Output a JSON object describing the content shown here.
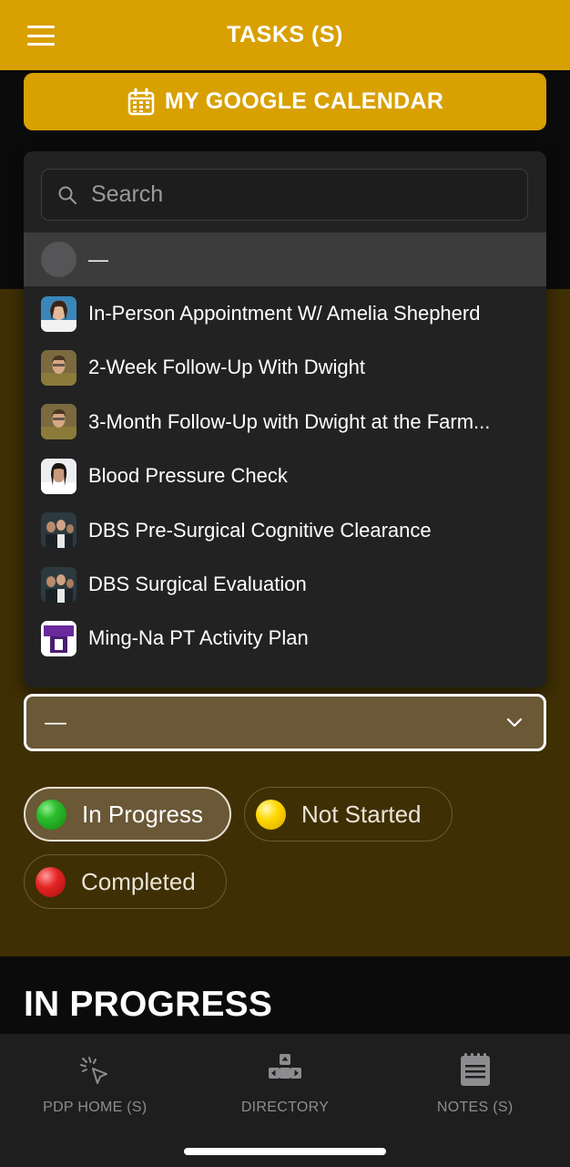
{
  "header": {
    "title": "TASKS (S)",
    "menu_icon": "hamburger-menu-icon"
  },
  "calendar_button": {
    "label": "MY GOOGLE CALENDAR",
    "icon": "calendar-icon"
  },
  "search": {
    "placeholder": "Search",
    "value": ""
  },
  "list": {
    "items": [
      {
        "label": "—",
        "selected": true,
        "thumb": "placeholder-circle"
      },
      {
        "label": "In-Person Appointment W/ Amelia Shepherd",
        "thumb": "avatar-amelia"
      },
      {
        "label": "2-Week Follow-Up With Dwight",
        "thumb": "avatar-dwight"
      },
      {
        "label": "3-Month Follow-Up with Dwight at the Farm...",
        "thumb": "avatar-dwight"
      },
      {
        "label": "Blood Pressure Check",
        "thumb": "avatar-doctor"
      },
      {
        "label": "DBS Pre-Surgical Cognitive Clearance",
        "thumb": "avatar-group"
      },
      {
        "label": "DBS Surgical Evaluation",
        "thumb": "avatar-group"
      },
      {
        "label": "Ming-Na PT Activity Plan",
        "thumb": "avatar-purple"
      }
    ]
  },
  "select": {
    "value": "—"
  },
  "filters": [
    {
      "label": "In Progress",
      "color": "#1fa81f",
      "active": true
    },
    {
      "label": "Not Started",
      "color": "#f2c400",
      "active": false
    },
    {
      "label": "Completed",
      "color": "#d61f1f",
      "active": false
    }
  ],
  "section": {
    "title": "IN PROGRESS"
  },
  "bottom_nav": [
    {
      "label": "PDP HOME (S)",
      "icon": "cursor-click-icon"
    },
    {
      "label": "DIRECTORY",
      "icon": "arrow-keys-icon"
    },
    {
      "label": "NOTES (S)",
      "icon": "notepad-icon"
    }
  ],
  "colors": {
    "accent": "#d8a000",
    "olive": "#3f2f04",
    "panel": "#222223"
  }
}
